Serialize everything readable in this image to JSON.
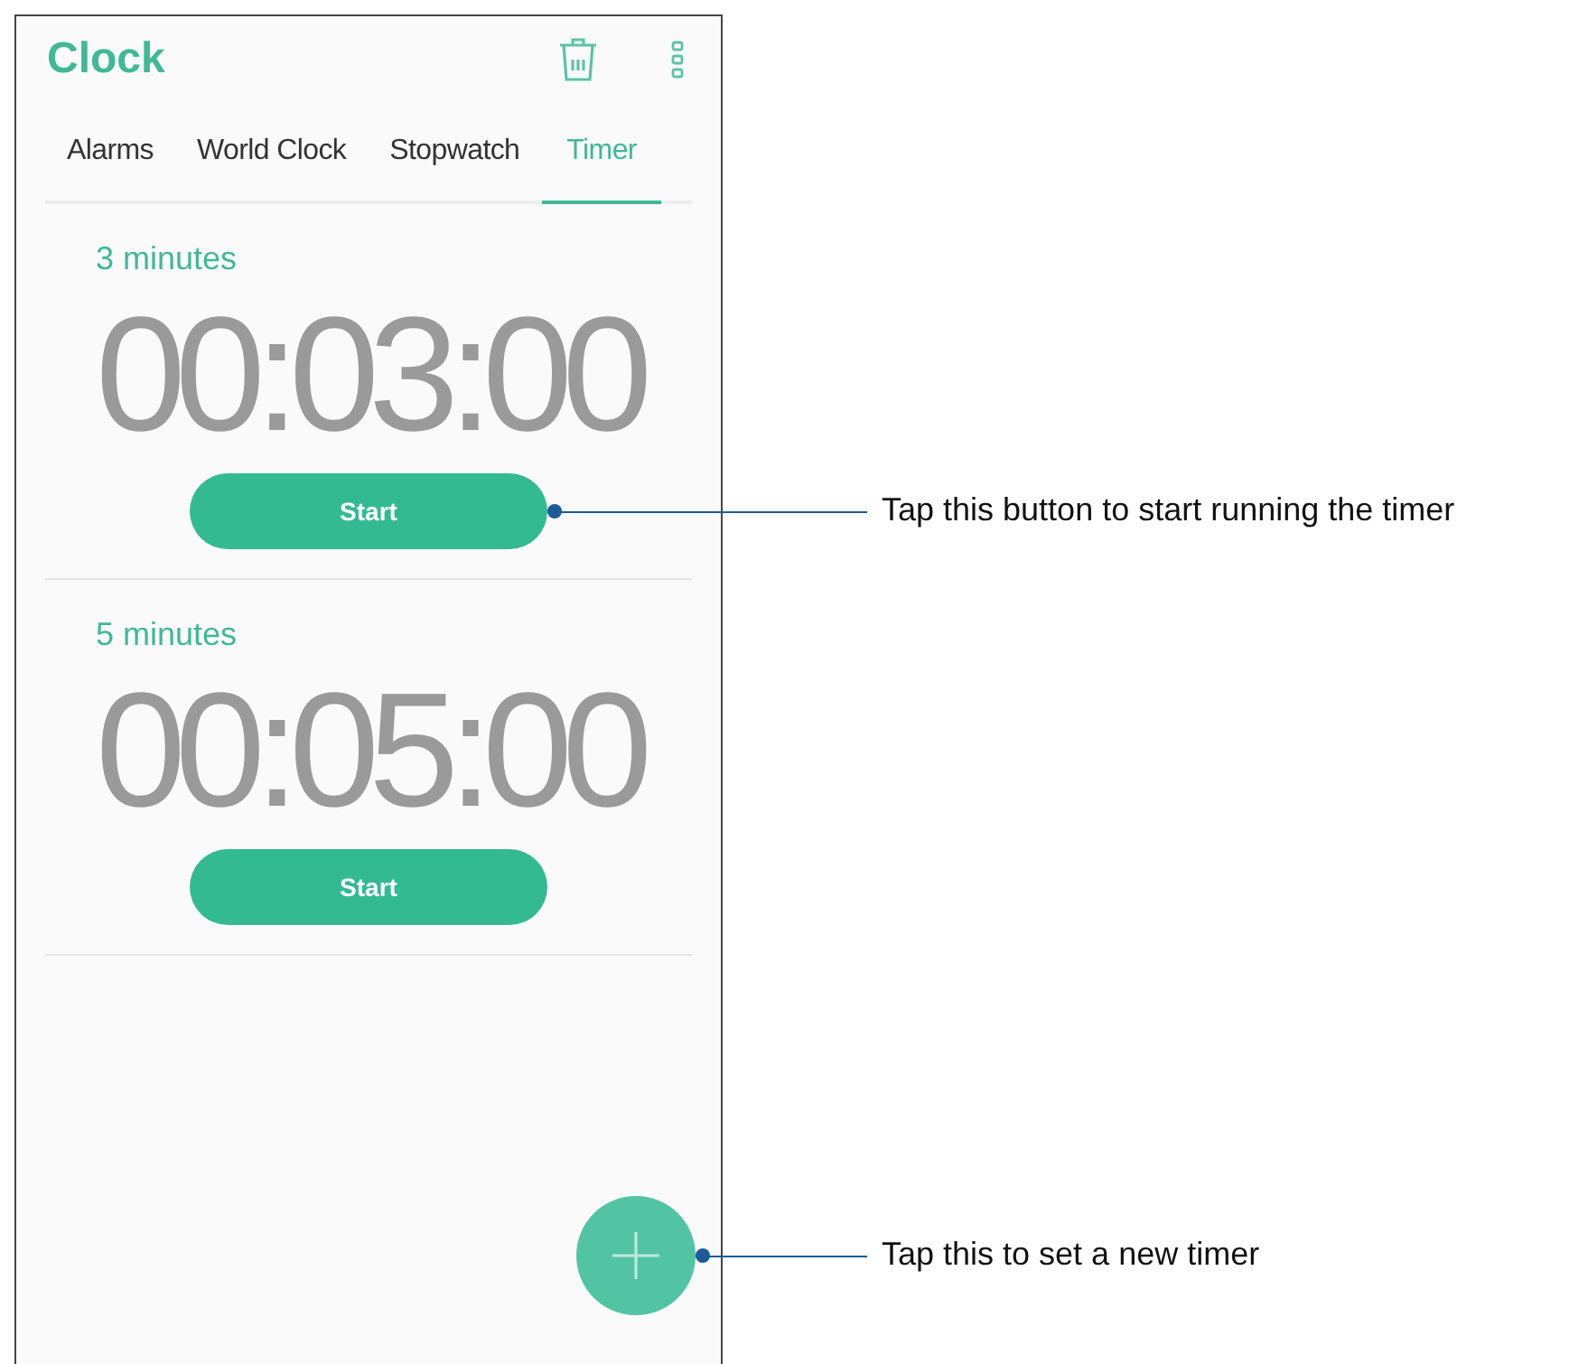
{
  "app_bar": {
    "title": "Clock"
  },
  "tabs": [
    {
      "label": "Alarms",
      "selected": false
    },
    {
      "label": "World Clock",
      "selected": false
    },
    {
      "label": "Stopwatch",
      "selected": false
    },
    {
      "label": "Timer",
      "selected": true
    }
  ],
  "timers": [
    {
      "label": "3 minutes",
      "time": "00:03:00",
      "button": "Start"
    },
    {
      "label": "5 minutes",
      "time": "00:05:00",
      "button": "Start"
    }
  ],
  "callouts": [
    {
      "text": "Tap this button to start running the timer"
    },
    {
      "text": "Tap this to set a new timer"
    }
  ]
}
